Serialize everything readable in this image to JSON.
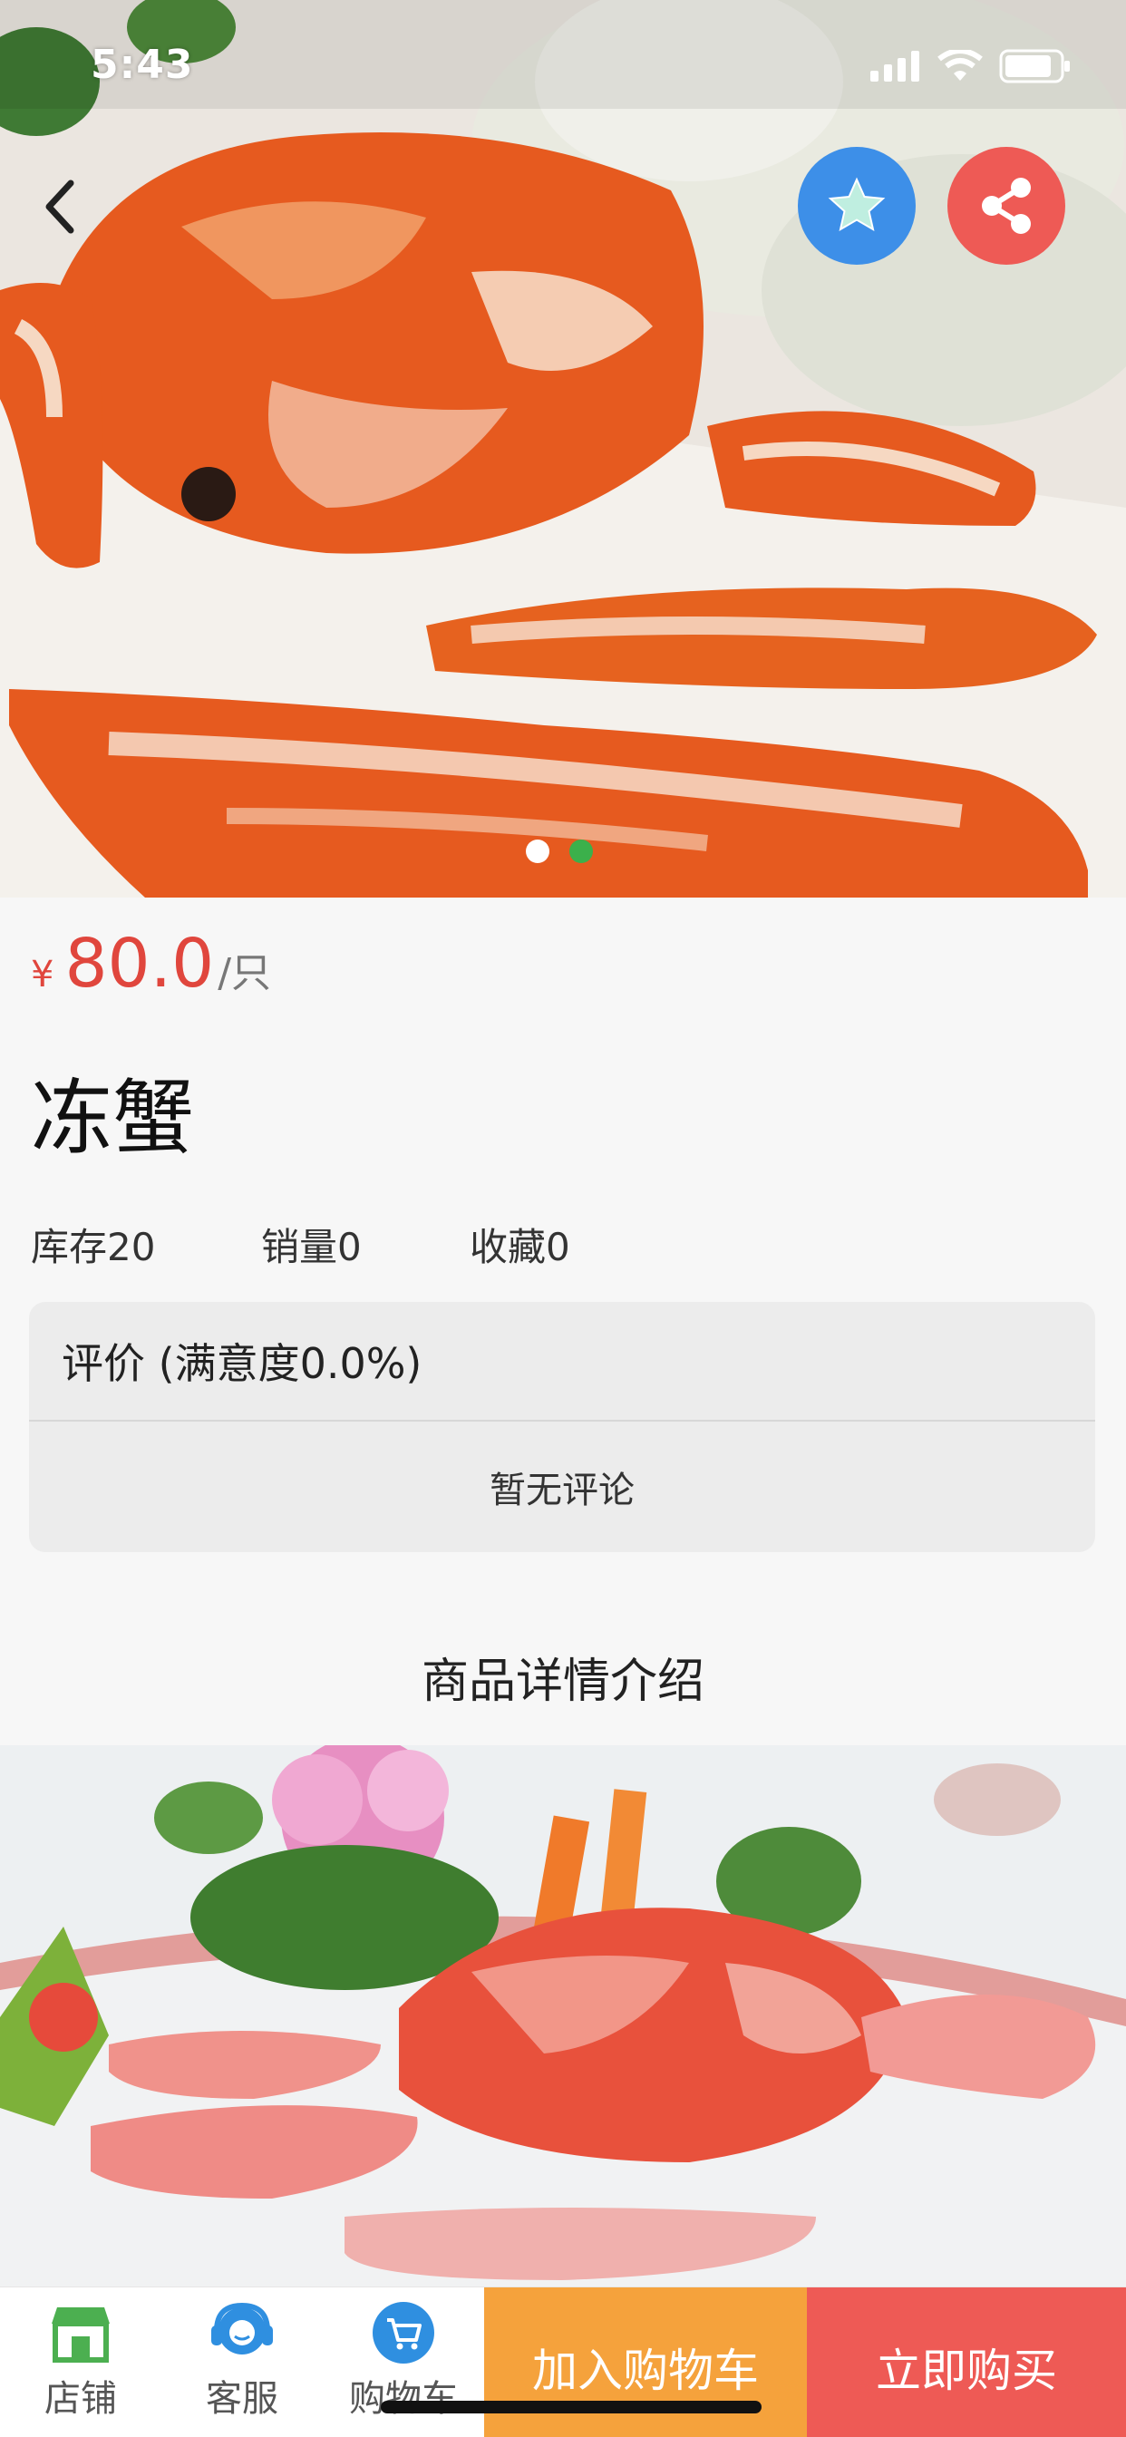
{
  "status_bar": {
    "time": "5:43",
    "icons": [
      "signal-icon",
      "wifi-icon",
      "battery-icon"
    ]
  },
  "hero": {
    "image": "crab-photo",
    "carousel": {
      "count": 2,
      "active_index": 1
    },
    "buttons": {
      "back": "back-icon",
      "favorite": "star-icon",
      "share": "share-icon"
    }
  },
  "product": {
    "currency_symbol": "¥",
    "price": "80.0",
    "unit": "/只",
    "name": "冻蟹",
    "stats": {
      "stock": "库存20",
      "sales": "销量0",
      "favorites": "收藏0"
    }
  },
  "reviews": {
    "header": "评价 (满意度0.0%)",
    "empty_text": "暂无评论"
  },
  "detail": {
    "title": "商品详情介绍",
    "image": "crab-dish-photo"
  },
  "bottom_bar": {
    "tabs": [
      {
        "label": "店铺",
        "icon": "store-icon"
      },
      {
        "label": "客服",
        "icon": "customer-service-icon"
      },
      {
        "label": "购物车",
        "icon": "cart-icon"
      }
    ],
    "add_to_cart": "加入购物车",
    "buy_now": "立即购买"
  },
  "colors": {
    "price": "#e0463d",
    "favorite_button": "#3d8fe8",
    "share_button": "#ee5a55",
    "add_to_cart": "#f5a23c",
    "buy_now": "#ee5a55",
    "carousel_active_dot": "#3bb04b"
  }
}
